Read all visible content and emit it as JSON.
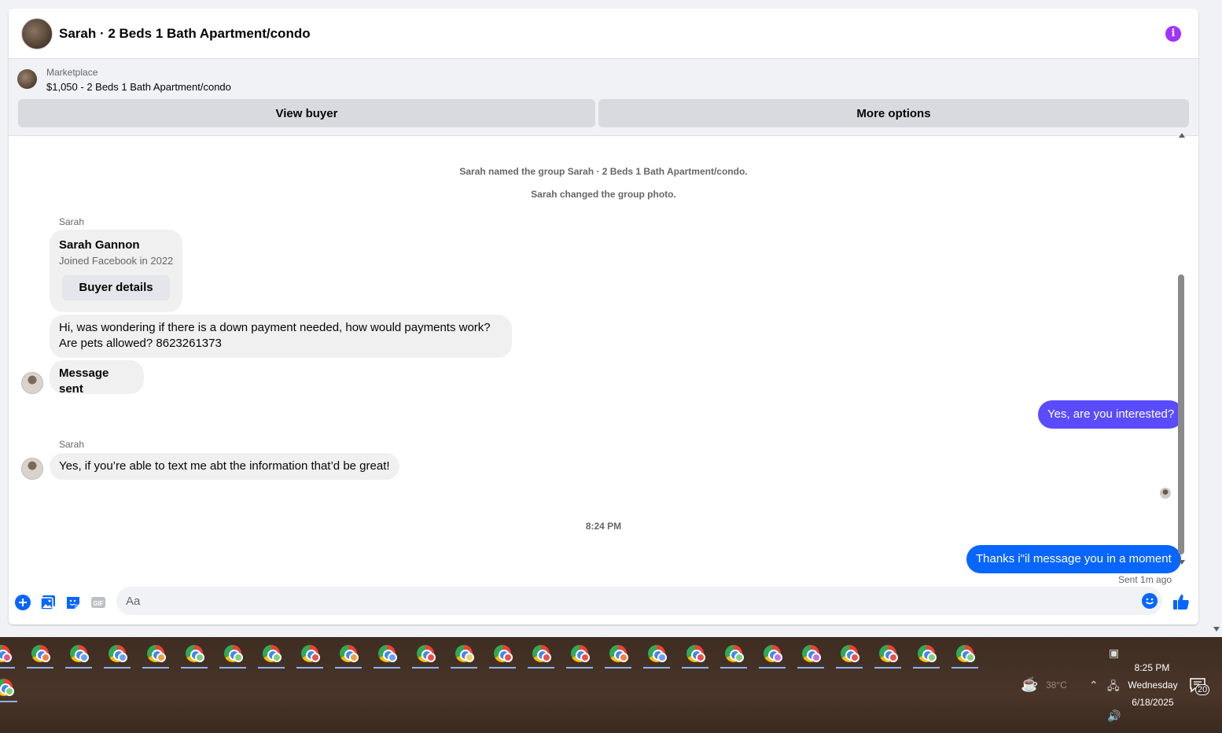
{
  "header": {
    "title": "Sarah · 2 Beds 1 Bath Apartment/condo",
    "info_icon": "info-icon",
    "accent_color": "#a033ff"
  },
  "marketplace": {
    "label": "Marketplace",
    "listing": "$1,050 - 2 Beds 1 Bath Apartment/condo",
    "view_buyer_label": "View buyer",
    "more_options_label": "More options"
  },
  "conversation": {
    "system_1": "Sarah named the group Sarah · 2 Beds 1 Bath Apartment/condo.",
    "system_2": "Sarah changed the group photo.",
    "sender_1": "Sarah",
    "card_name": "Sarah Gannon",
    "card_sub": "Joined Facebook in 2022",
    "card_button": "Buyer details",
    "msg_in_1_line1": "Hi, was wondering if there is a down payment needed, how would payments work?",
    "msg_in_1_line2": "Are pets allowed? 8623261373",
    "msg_in_2": "Message sent",
    "msg_out_1": "Yes, are you interested?",
    "sender_2": "Sarah",
    "msg_in_3": "Yes, if you’re able to text me abt the information that’d be great!",
    "time_divider": "8:24 PM",
    "msg_out_2": "Thanks i\"il message you in a moment",
    "sent_status": "Sent 1m ago",
    "out_color_1": "#5b4bff",
    "out_color_2": "#0866ff"
  },
  "composer": {
    "placeholder": "Aa",
    "icons": [
      "plus-icon",
      "image-icon",
      "sticker-icon",
      "gif-icon",
      "emoji-icon",
      "thumbs-up-icon"
    ]
  },
  "taskbar": {
    "apps": [
      {
        "badge": "#e8558f"
      },
      {
        "badge": "#f08040"
      },
      {
        "badge": "#6aa0ff"
      },
      {
        "badge": "#6aa0ff"
      },
      {
        "badge": "#f0a040"
      },
      {
        "badge": "#7ecf7e"
      },
      {
        "badge": "#7ecf7e"
      },
      {
        "badge": "#7ecf7e"
      },
      {
        "badge": "#e85050"
      },
      {
        "badge": "#f0a040"
      },
      {
        "badge": "#6aa0ff"
      },
      {
        "badge": "#e85050"
      },
      {
        "badge": "#f0d060"
      },
      {
        "badge": "#e85050"
      },
      {
        "badge": "#e85050"
      },
      {
        "badge": "#e85050"
      },
      {
        "badge": "#f08040"
      },
      {
        "badge": "#6aa0ff"
      },
      {
        "badge": "#e85050"
      },
      {
        "badge": "#7ecf7e"
      },
      {
        "badge": "#c070e0"
      },
      {
        "badge": "#c070e0"
      },
      {
        "badge": "#e85050"
      },
      {
        "badge": "#e85050"
      },
      {
        "badge": "#7ecf7e"
      },
      {
        "badge": "#7ecf7e"
      }
    ],
    "weather": "38°C",
    "time": "8:25 PM",
    "day": "Wednesday",
    "date": "6/18/2025",
    "notification_count": "20"
  }
}
